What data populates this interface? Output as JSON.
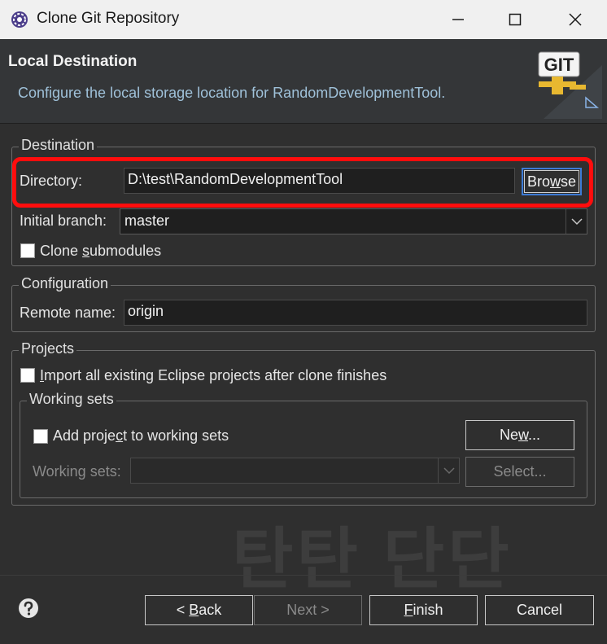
{
  "window": {
    "title": "Clone Git Repository",
    "app_icon": "eclipse-gear-icon",
    "controls": [
      "minimize-icon",
      "maximize-icon",
      "close-icon"
    ]
  },
  "banner": {
    "heading": "Local Destination",
    "description": "Configure the local storage location for RandomDevelopmentTool.",
    "logo_text": "GIT"
  },
  "destination": {
    "group_label": "Destination",
    "directory_label": "Directory:",
    "directory_value": "D:\\test\\RandomDevelopmentTool",
    "browse_label_pre": "Bro",
    "browse_label_mnemonic": "w",
    "browse_label_post": "se",
    "initial_branch_label": "Initial branch:",
    "initial_branch_value": "master",
    "clone_submodules_pre": "Clone ",
    "clone_submodules_mnemonic": "s",
    "clone_submodules_post": "ubmodules",
    "clone_submodules_checked": false
  },
  "configuration": {
    "group_label": "Configuration",
    "remote_name_label": "Remote name:",
    "remote_name_value": "origin"
  },
  "projects": {
    "group_label": "Projects",
    "import_mnemonic": "I",
    "import_rest": "mport all existing Eclipse projects after clone finishes",
    "import_checked": false,
    "working_sets": {
      "group_label": "Working sets",
      "add_pre": "Add proje",
      "add_mnemonic": "c",
      "add_post": "t to working sets",
      "add_checked": false,
      "new_pre": "Ne",
      "new_mnemonic": "w",
      "new_post": "...",
      "working_sets_label": "Working sets:",
      "working_sets_value": "",
      "select_label": "Select..."
    }
  },
  "footer": {
    "back_pre": "< ",
    "back_mnemonic": "B",
    "back_post": "ack",
    "next_label": "Next >",
    "finish_mnemonic": "F",
    "finish_post": "inish",
    "cancel_label": "Cancel"
  },
  "watermark": "탄탄 단단",
  "colors": {
    "highlight": "#ff0d0d",
    "dialog_bg": "#2f2f2f",
    "banner_description": "#9fc1d9",
    "focus": "#3d7bd6"
  }
}
